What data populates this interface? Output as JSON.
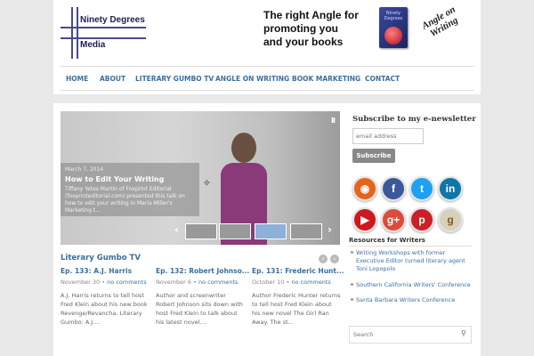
{
  "header": {
    "logo_line1": "Ninety Degrees",
    "logo_line2": "Media",
    "banner_line1": "The right Angle for",
    "banner_line2": "promoting you",
    "banner_line3": "and your books",
    "book_label": "Ninety Degrees",
    "angle_line1": "Angle on",
    "angle_line2": "Writing"
  },
  "nav": {
    "items": [
      {
        "label": "HOME"
      },
      {
        "label": "ABOUT"
      },
      {
        "label": "LITERARY GUMBO TV"
      },
      {
        "label": "ANGLE ON WRITING"
      },
      {
        "label": "BOOK MARKETING"
      },
      {
        "label": "CONTACT"
      }
    ]
  },
  "slider": {
    "pause_label": "II",
    "date": "March 7, 2014",
    "title": "How to Edit Your Writing",
    "text": "Tiffany Yates Martin of Foxprint Editorial (foxprinteditorial.com) presented this talk on how to edit your writing in Maria Miller's Marketing t...",
    "prev_arrow": "‹",
    "next_arrow": "›"
  },
  "gumbo": {
    "title": "Literary Gumbo TV",
    "prev": "‹",
    "next": "›",
    "posts": [
      {
        "title": "Ep. 133: A.J. Harris",
        "date": "November 30",
        "sep": "•",
        "comments": "no comments",
        "excerpt": "A.J. Harris returns to tell host Fred Klein about his new book Revenge/Revancha. Literary Gumbo: A.J...."
      },
      {
        "title": "Ep. 132: Robert Johnso...",
        "date": "November 6",
        "sep": "•",
        "comments": "no comments",
        "excerpt": "Author and screenwriter Robert Johnson sits down with host Fred Klein to talk about his latest novel...."
      },
      {
        "title": "Ep. 131: Frederic Hunt...",
        "date": "October 10",
        "sep": "•",
        "comments": "no comments",
        "excerpt": "Author Frederic Hunter returns to tell host Fred Klein about his new novel The Girl Ran Away. The st..."
      }
    ]
  },
  "sidebar": {
    "subscribe_title": "Subscribe to my e-newsletter",
    "email_placeholder": "email address",
    "subscribe_button": "Subscribe",
    "social": [
      {
        "name": "rss",
        "glyph": "◉",
        "color": "#e8641b"
      },
      {
        "name": "facebook",
        "glyph": "f",
        "color": "#3b5998"
      },
      {
        "name": "twitter",
        "glyph": "t",
        "color": "#1da1f2"
      },
      {
        "name": "linkedin",
        "glyph": "in",
        "color": "#0e76a8"
      },
      {
        "name": "youtube",
        "glyph": "▶",
        "color": "#cc181e"
      },
      {
        "name": "google-plus",
        "glyph": "g+",
        "color": "#dd4b39"
      },
      {
        "name": "pinterest",
        "glyph": "p",
        "color": "#cb2027"
      },
      {
        "name": "goodreads",
        "glyph": "g",
        "color": "#d8d0b8"
      }
    ],
    "resources_title": "Resources for Writers",
    "resources": [
      {
        "label": "Writing Workshops with former Executive Editor turned literary agent Toni Lopopolo"
      },
      {
        "label": "Southern California Writers' Conference"
      },
      {
        "label": "Santa Barbara Writers Conference"
      }
    ],
    "search_placeholder": "Search"
  }
}
